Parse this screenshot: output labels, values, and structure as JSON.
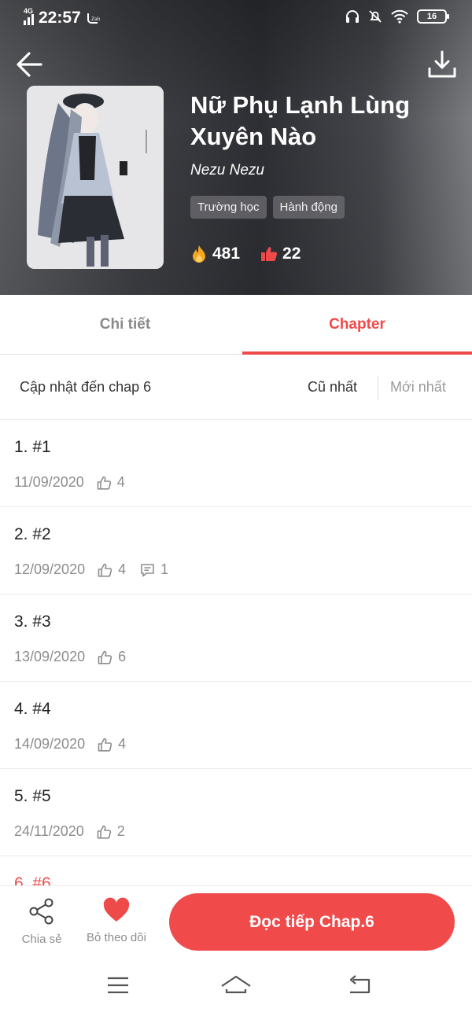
{
  "status_bar": {
    "time": "22:57",
    "network": "4G",
    "battery": "16"
  },
  "book": {
    "title": "Nữ Phụ Lạnh Lùng Xuyên Nào",
    "author": "Nezu Nezu",
    "tags": [
      "Trường học",
      "Hành động"
    ],
    "views": "481",
    "likes": "22"
  },
  "tabs": {
    "detail": "Chi tiết",
    "chapter": "Chapter"
  },
  "sort": {
    "update_text": "Cập nhật đến chap 6",
    "oldest": "Cũ nhất",
    "newest": "Mới nhất"
  },
  "chapters": [
    {
      "title": "1. #1",
      "date": "11/09/2020",
      "likes": "4",
      "comments": ""
    },
    {
      "title": "2. #2",
      "date": "12/09/2020",
      "likes": "4",
      "comments": "1"
    },
    {
      "title": "3. #3",
      "date": "13/09/2020",
      "likes": "6",
      "comments": ""
    },
    {
      "title": "4. #4",
      "date": "14/09/2020",
      "likes": "4",
      "comments": ""
    },
    {
      "title": "5. #5",
      "date": "24/11/2020",
      "likes": "2",
      "comments": ""
    },
    {
      "title": "6. #6",
      "date": "",
      "likes": "",
      "comments": ""
    }
  ],
  "bottom": {
    "share_label": "Chia sẻ",
    "follow_label": "Bỏ theo dõi",
    "read_label": "Đọc tiếp Chap.6"
  },
  "colors": {
    "accent": "#ef4a4a",
    "fire": "#f5a623",
    "like": "#ef4a4a"
  },
  "icons": [
    "back-arrow-icon",
    "download-icon",
    "fire-icon",
    "thumbs-up-icon",
    "comment-icon",
    "share-icon",
    "heart-icon",
    "menu-icon",
    "home-icon",
    "return-icon"
  ]
}
